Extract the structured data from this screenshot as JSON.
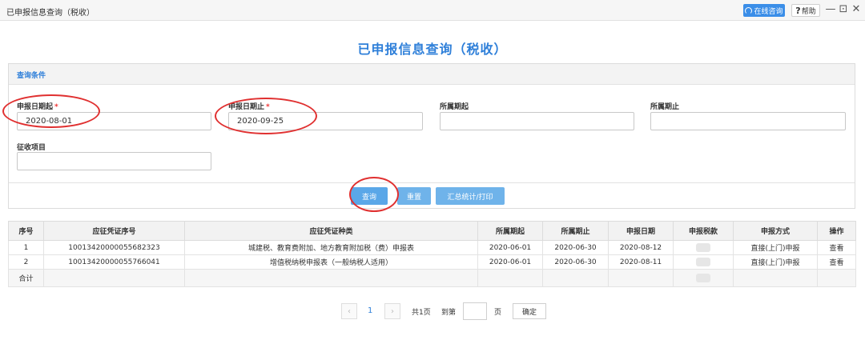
{
  "window": {
    "title": "已申报信息查询（税收）",
    "online_label": "在线咨询",
    "help_label": "帮助",
    "help_glyph": "?",
    "minimize_glyph": "—",
    "restore_glyph": "⊡",
    "close_glyph": "✕"
  },
  "page": {
    "title": "已申报信息查询（税收）"
  },
  "query": {
    "section_label": "查询条件",
    "fields": {
      "date_start": {
        "label": "申报日期起",
        "required": "*",
        "value": "2020-08-01"
      },
      "date_end": {
        "label": "申报日期止",
        "required": "*",
        "value": "2020-09-25"
      },
      "period_start": {
        "label": "所属期起",
        "value": ""
      },
      "period_end": {
        "label": "所属期止",
        "value": ""
      },
      "levy_item": {
        "label": "征收项目",
        "value": ""
      }
    },
    "buttons": {
      "query": "查询",
      "reset": "重置",
      "summary": "汇总统计/打印"
    }
  },
  "table": {
    "headers": [
      "序号",
      "应征凭证序号",
      "应征凭证种类",
      "所属期起",
      "所属期止",
      "申报日期",
      "申报税款",
      "申报方式",
      "操作"
    ],
    "rows": [
      {
        "no": "1",
        "voucher_no": "10013420000055682323",
        "voucher_type": "城建税、教育费附加、地方教育附加税（费）申报表",
        "period_start": "2020-06-01",
        "period_end": "2020-06-30",
        "declare_date": "2020-08-12",
        "method": "直接(上门)申报",
        "action": "查看"
      },
      {
        "no": "2",
        "voucher_no": "10013420000055766041",
        "voucher_type": "增值税纳税申报表（一般纳税人适用）",
        "period_start": "2020-06-01",
        "period_end": "2020-06-30",
        "declare_date": "2020-08-11",
        "method": "直接(上门)申报",
        "action": "查看"
      }
    ],
    "total_label": "合计"
  },
  "pager": {
    "prev": "‹",
    "current": "1",
    "next": "›",
    "total_pages": "共1页",
    "goto_label": "到第",
    "page_unit": "页",
    "confirm": "确定"
  },
  "colors": {
    "accent": "#2e7fd9",
    "button": "#6fb3ea",
    "annotation": "#e03030"
  }
}
